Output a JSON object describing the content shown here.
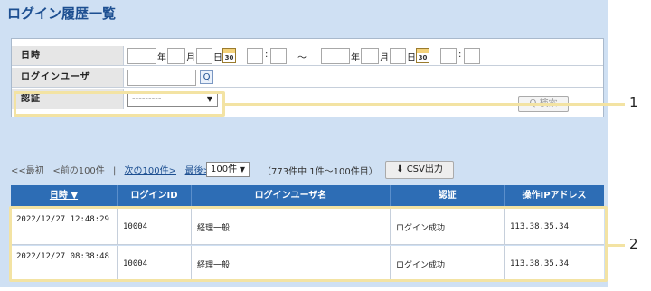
{
  "page": {
    "title": "ログイン履歴一覧"
  },
  "search": {
    "datetime_label": "日時",
    "year": "年",
    "month": "月",
    "day": "日",
    "calendar_text": "30",
    "colon": ":",
    "tilde": "～",
    "user_label": "ログインユーザ",
    "lookup_icon": "Q",
    "auth_label": "認証",
    "auth_selected": "---------",
    "search_button": "Q 検索"
  },
  "pager": {
    "first": "<<最初",
    "prev": "<前の100件",
    "separator": "|",
    "next": "次の100件>",
    "last": "最後>>",
    "page_size": "100件",
    "range_info": "（773件中 1件～100件目）",
    "csv_button": "CSV出力"
  },
  "table": {
    "columns": [
      "日時 ▼",
      "ログインID",
      "ログインユーザ名",
      "認証",
      "操作IPアドレス"
    ],
    "rows": [
      {
        "datetime": "2022/12/27 12:48:29",
        "login_id": "10004",
        "user_name": "経理一般",
        "auth": "ログイン成功",
        "ip": "113.38.35.34"
      },
      {
        "datetime": "2022/12/27 08:38:48",
        "login_id": "10004",
        "user_name": "経理一般",
        "auth": "ログイン成功",
        "ip": "113.38.35.34"
      }
    ]
  },
  "callouts": {
    "one": "1",
    "two": "2"
  },
  "colors": {
    "accent": "#2d6db5",
    "panel": "#cfe0f3",
    "highlight": "#f3e3a3",
    "title": "#1d4f91"
  }
}
